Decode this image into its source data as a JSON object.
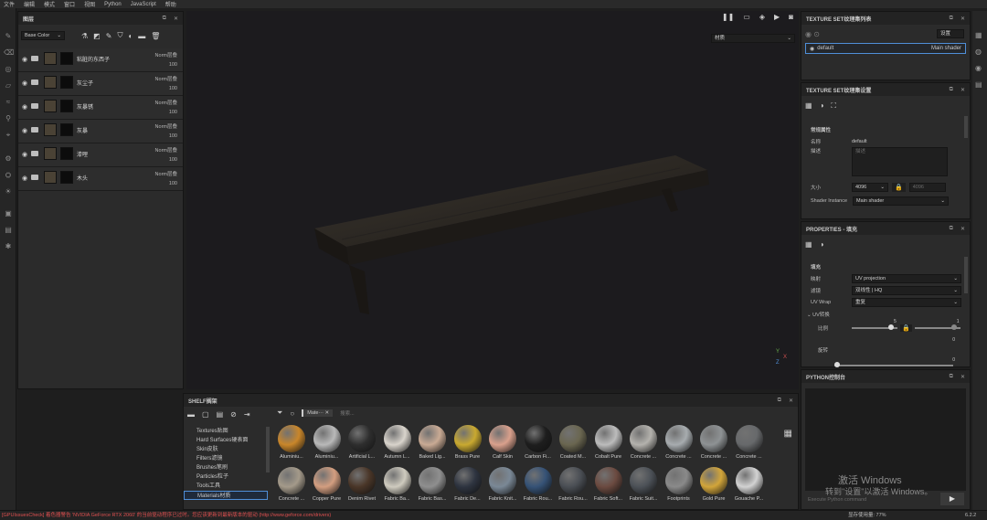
{
  "menu": [
    "文件",
    "编辑",
    "模式",
    "窗口",
    "视图",
    "Python",
    "JavaScript",
    "帮助"
  ],
  "layers_panel": {
    "title": "图层",
    "channel_select": "Base Color",
    "layers": [
      {
        "name": "粘脏的东西子",
        "blend": "Norm层叠",
        "opacity": "100"
      },
      {
        "name": "灰尘子",
        "blend": "Norm层叠",
        "opacity": "100"
      },
      {
        "name": "灰暴锈",
        "blend": "Norm层叠",
        "opacity": "100"
      },
      {
        "name": "灰暴",
        "blend": "Norm层叠",
        "opacity": "100"
      },
      {
        "name": "漆哩",
        "blend": "Norm层叠",
        "opacity": "100"
      },
      {
        "name": "木头",
        "blend": "Norm层叠",
        "opacity": "100"
      }
    ]
  },
  "viewport": {
    "mode_select": "材质",
    "axis_labels": [
      "Y",
      "X",
      "Z"
    ]
  },
  "texture_set_list": {
    "title": "TEXTURE SET纹理集列表",
    "settings_btn": "设置",
    "items": [
      {
        "name": "default",
        "shader": "Main shader"
      }
    ]
  },
  "texture_set_settings": {
    "title": "TEXTURE SET纹理集设置",
    "section": "常规属性",
    "name_label": "名称",
    "name_value": "default",
    "desc_label": "描述",
    "desc_placeholder": "描述",
    "size_label": "大小",
    "size_value": "4096",
    "size_value2": "4096",
    "shader_label": "Shader Instance",
    "shader_value": "Main shader"
  },
  "properties": {
    "title": "PROPERTIES - 填充",
    "section": "填充",
    "mapping_label": "映射",
    "mapping_value": "UV projection",
    "filter_label": "滤镜",
    "filter_value": "双线性 | HQ",
    "uvwrap_label": "UV Wrap",
    "uvwrap_value": "重复",
    "uvtrans_label": "UV转换",
    "scale_label": "比例",
    "scale_value": "5",
    "scale_value2": "1",
    "scale_min": "0",
    "rotate_label": "旋转",
    "rotate_min": "0",
    "offset_min": "0"
  },
  "python_console": {
    "title": "PYTHON控制台",
    "placeholder": "Execute Python command",
    "watermark_line1": "激活 Windows",
    "watermark_line2": "转到\"设置\"以激活 Windows。"
  },
  "shelf": {
    "title": "SHELF搁架",
    "filter_chip": "Mate···",
    "search_placeholder": "搜索...",
    "categories": [
      "Textures贴图",
      "Hard Surfaces硬表面",
      "Skin皮肤",
      "Filters滤镜",
      "Brushes笔刷",
      "Particles粒子",
      "Tools工具",
      "Materials材质"
    ],
    "materials_row1": [
      {
        "name": "Aluminiu...",
        "color": "#c9862a"
      },
      {
        "name": "Aluminiu...",
        "color": "#b9b9b9"
      },
      {
        "name": "Artificial L...",
        "color": "#2e2e2e"
      },
      {
        "name": "Autumn L...",
        "color": "#d9d4cc"
      },
      {
        "name": "Baked Lig...",
        "color": "#c9aa94"
      },
      {
        "name": "Brass Pure",
        "color": "#c9a930"
      },
      {
        "name": "Calf Skin",
        "color": "#d9a08c"
      },
      {
        "name": "Carbon Fi...",
        "color": "#1e1e1e"
      },
      {
        "name": "Coated M...",
        "color": "#6a6650"
      },
      {
        "name": "Cobalt Pure",
        "color": "#bcbcbc"
      },
      {
        "name": "Concrete ...",
        "color": "#b4b2ad"
      },
      {
        "name": "Concrete ...",
        "color": "#a7acaf"
      },
      {
        "name": "Concrete ...",
        "color": "#8e9294"
      },
      {
        "name": "Concrete ...",
        "color": "#67696b"
      }
    ],
    "materials_row2": [
      {
        "name": "Concrete ...",
        "color": "#a49a8a"
      },
      {
        "name": "Copper Pure",
        "color": "#d39e80"
      },
      {
        "name": "Denim Rivet",
        "color": "#4a3628"
      },
      {
        "name": "Fabric Ba...",
        "color": "#cfcbbf"
      },
      {
        "name": "Fabric Bas...",
        "color": "#8f8f8f"
      },
      {
        "name": "Fabric De...",
        "color": "#2e3440"
      },
      {
        "name": "Fabric Knit...",
        "color": "#7a8896"
      },
      {
        "name": "Fabric Rou...",
        "color": "#355276"
      },
      {
        "name": "Fabric Rou...",
        "color": "#4a4e54"
      },
      {
        "name": "Fabric Soft...",
        "color": "#6b4a40"
      },
      {
        "name": "Fabric Suit...",
        "color": "#4c5157"
      },
      {
        "name": "Footprints",
        "color": "#8a8a8a"
      },
      {
        "name": "Gold Pure",
        "color": "#d2a53a"
      },
      {
        "name": "Gouache P...",
        "color": "#d2d2d2"
      }
    ]
  },
  "status": {
    "error_text": "[GPUIssuesCheck] 着色器警告 'NVIDIA GeForce RTX 2060' 的当前驱动程序已过时。您应该更新到最新版本的驱动 (http://www.geforce.com/drivers)",
    "memory_label": "显存使用量: 77%",
    "version": "6.2.2"
  },
  "colors": {
    "accent": "#4f8fd8",
    "error": "#e05050",
    "panel": "#2b2b2b",
    "viewport": "#1c1b1e"
  }
}
